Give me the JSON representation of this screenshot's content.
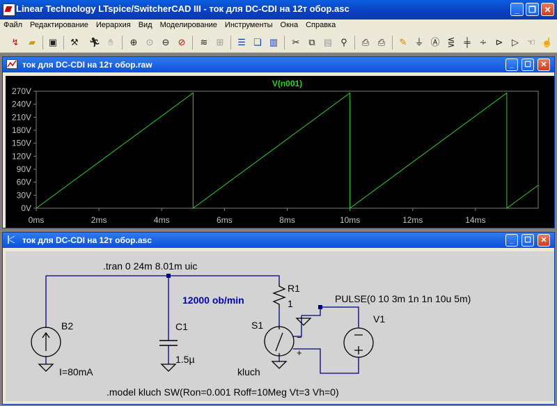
{
  "window": {
    "title": "Linear Technology LTspice/SwitcherCAD III - ток для DC-CDI на 12т обор.asc"
  },
  "menu": [
    "Файл",
    "Редактирование",
    "Иерархия",
    "Вид",
    "Моделирование",
    "Инструменты",
    "Окна",
    "Справка"
  ],
  "toolbar_icons": [
    "open-icon",
    "folder-icon",
    "save-icon",
    "hammer-icon",
    "run-icon",
    "hand-icon",
    "zoom-in-icon",
    "zoom-extent-icon",
    "zoom-out-icon",
    "zoom-cancel-icon",
    "autorange-icon",
    "grid-icon",
    "tile-horizontal-icon",
    "cascade-icon",
    "tile-vertical-icon",
    "cut-icon",
    "copy-icon",
    "paste-icon",
    "find-icon",
    "print-setup-icon",
    "print-icon",
    "wire-icon",
    "ground-icon",
    "label-icon",
    "resistor-icon",
    "capacitor-icon",
    "inductor-icon",
    "diode-icon",
    "component-icon",
    "move-icon",
    "drag-icon"
  ],
  "waveform": {
    "title": "ток для DC-CDI на 12т обор.raw",
    "trace_label": "V(n001)"
  },
  "chart_data": {
    "type": "line",
    "title": "",
    "series": [
      {
        "name": "V(n001)",
        "color": "#2fd02f",
        "x": [
          0,
          5.0,
          5.0,
          10.0,
          10.0,
          15.0,
          15.0,
          16.0
        ],
        "y": [
          0,
          266,
          0,
          266,
          0,
          266,
          0,
          53
        ]
      }
    ],
    "xlim": [
      0,
      16
    ],
    "ylim": [
      0,
      270
    ],
    "xticks": [
      "0ms",
      "2ms",
      "4ms",
      "6ms",
      "8ms",
      "10ms",
      "12ms",
      "14ms"
    ],
    "xtick_values": [
      0,
      2,
      4,
      6,
      8,
      10,
      12,
      14
    ],
    "yticks": [
      "0V",
      "30V",
      "60V",
      "90V",
      "120V",
      "150V",
      "180V",
      "210V",
      "240V",
      "270V"
    ],
    "ytick_values": [
      0,
      30,
      60,
      90,
      120,
      150,
      180,
      210,
      240,
      270
    ],
    "grid": false,
    "background": "#000000",
    "axis_color": "#808080",
    "label_color": "#c0c0c0"
  },
  "schematic": {
    "title": "ток для DC-CDI на 12т обор.asc",
    "directive_tran": ".tran 0 24m 8.01m uic",
    "comment_speed": "12000 ob/min",
    "b2_name": "B2",
    "b2_value": "I=80mA",
    "c1_name": "C1",
    "c1_value": "1.5µ",
    "r1_name": "R1",
    "r1_value": "1",
    "s1_name": "S1",
    "s1_model": "kluch",
    "v1_name": "V1",
    "v1_value": "PULSE(0 10 3m 1n 1n 10u 5m)",
    "minus": "−",
    "plus": "+",
    "model_line": ".model kluch SW(Ron=0.001 Roff=10Meg Vt=3 Vh=0)",
    "wire_color": "#000080",
    "comment_color": "#0000c0"
  }
}
